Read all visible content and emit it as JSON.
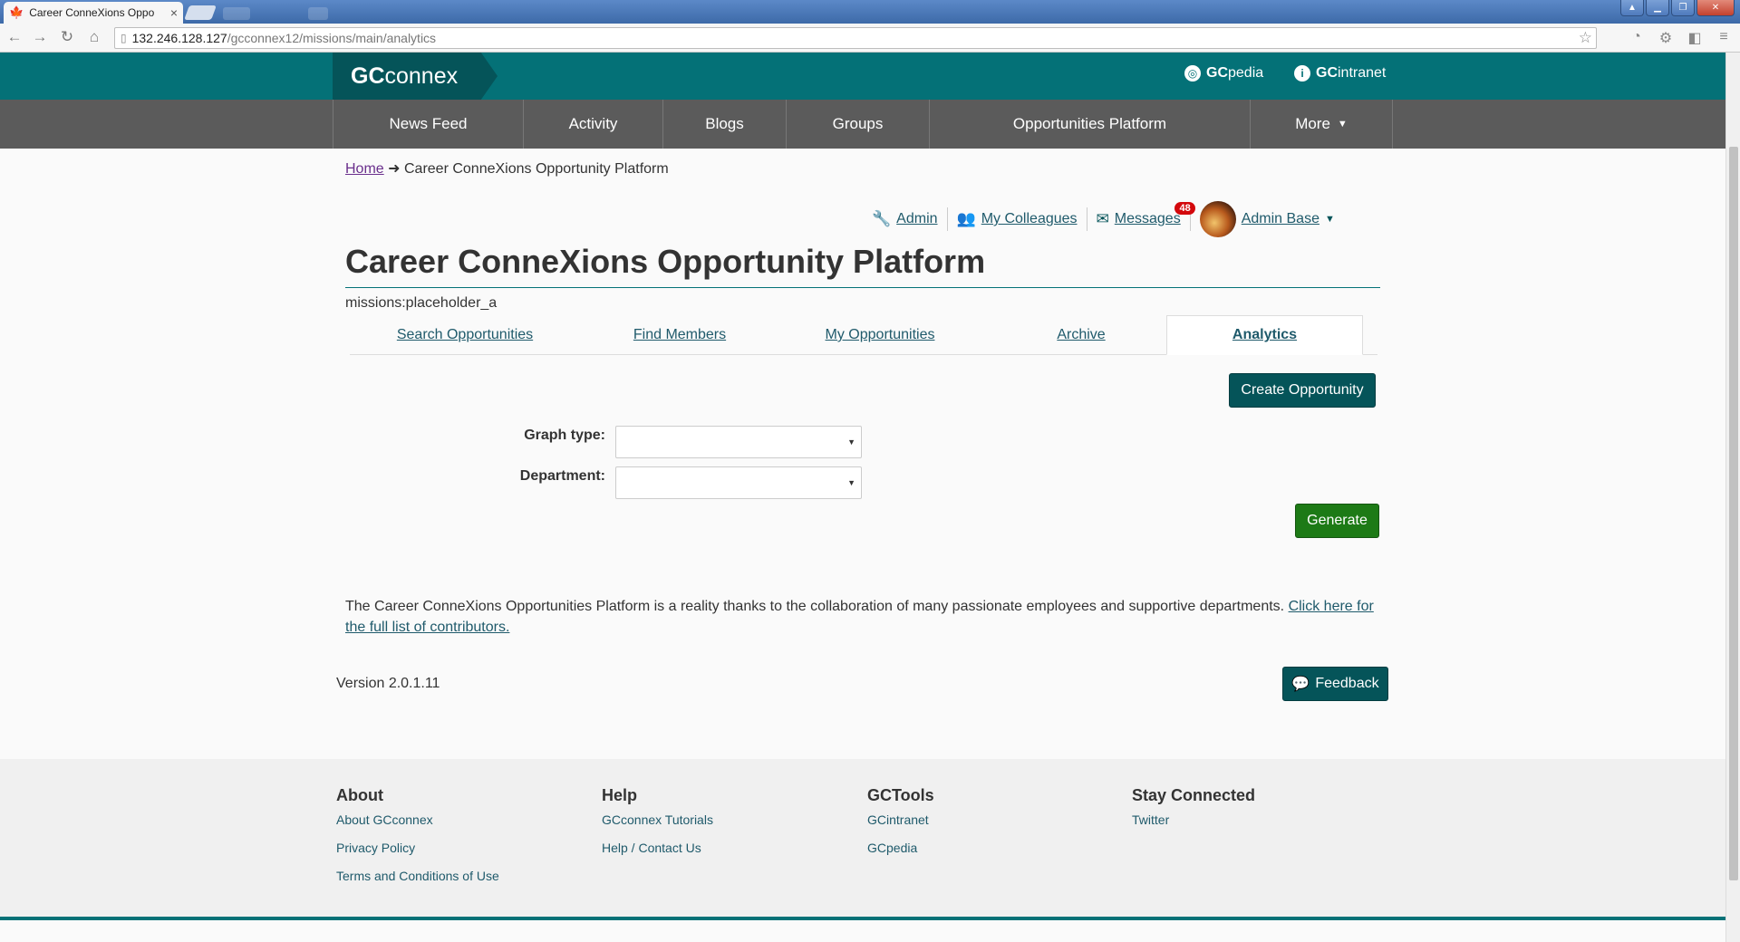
{
  "browser": {
    "tab_title": "Career ConneXions Oppo",
    "url_host": "132.246.128.127",
    "url_path": "/gcconnex12/missions/main/analytics"
  },
  "header": {
    "logo_prefix": "GC",
    "logo_suffix": "connex",
    "links": [
      {
        "prefix": "GC",
        "suffix": "pedia",
        "icon": "globe-icon"
      },
      {
        "prefix": "GC",
        "suffix": "intranet",
        "icon": "info-icon"
      }
    ]
  },
  "nav": {
    "items": [
      "News Feed",
      "Activity",
      "Blogs",
      "Groups",
      "Opportunities Platform"
    ],
    "more_label": "More"
  },
  "breadcrumb": {
    "home": "Home",
    "separator": "➜",
    "current": "Career ConneXions Opportunity Platform"
  },
  "user_menu": {
    "admin": "Admin",
    "colleagues": "My Colleagues",
    "messages": "Messages",
    "messages_count": "48",
    "user": "Admin Base"
  },
  "page": {
    "title": "Career ConneXions Opportunity Platform",
    "subtitle": "missions:placeholder_a"
  },
  "tabs": [
    {
      "label": "Search Opportunities",
      "active": false
    },
    {
      "label": "Find Members",
      "active": false
    },
    {
      "label": "My Opportunities",
      "active": false
    },
    {
      "label": "Archive",
      "active": false
    },
    {
      "label": "Analytics",
      "active": true
    }
  ],
  "actions": {
    "create": "Create Opportunity",
    "generate": "Generate",
    "feedback": "Feedback"
  },
  "form": {
    "graph_type_label": "Graph type:",
    "graph_type_value": "",
    "department_label": "Department:",
    "department_value": ""
  },
  "credits": {
    "text": "The Career ConneXions Opportunities Platform is a reality thanks to the collaboration of many passionate employees and supportive departments. ",
    "link": "Click here for the full list of contributors."
  },
  "version": "Version 2.0.1.11",
  "footer": {
    "about": {
      "heading": "About",
      "links": [
        "About GCconnex",
        "Privacy Policy",
        "Terms and Conditions of Use"
      ]
    },
    "help": {
      "heading": "Help",
      "links": [
        "GCconnex Tutorials",
        "Help / Contact Us"
      ]
    },
    "gctools": {
      "heading": "GCTools",
      "links": [
        "GCintranet",
        "GCpedia"
      ]
    },
    "stay": {
      "heading": "Stay Connected",
      "links": [
        "Twitter"
      ]
    }
  },
  "colors": {
    "brand_teal": "#047177",
    "brand_dark": "#055459",
    "nav_gray": "#5b5b5b",
    "generate_green": "#1d7a16",
    "badge_red": "#d3080c"
  }
}
